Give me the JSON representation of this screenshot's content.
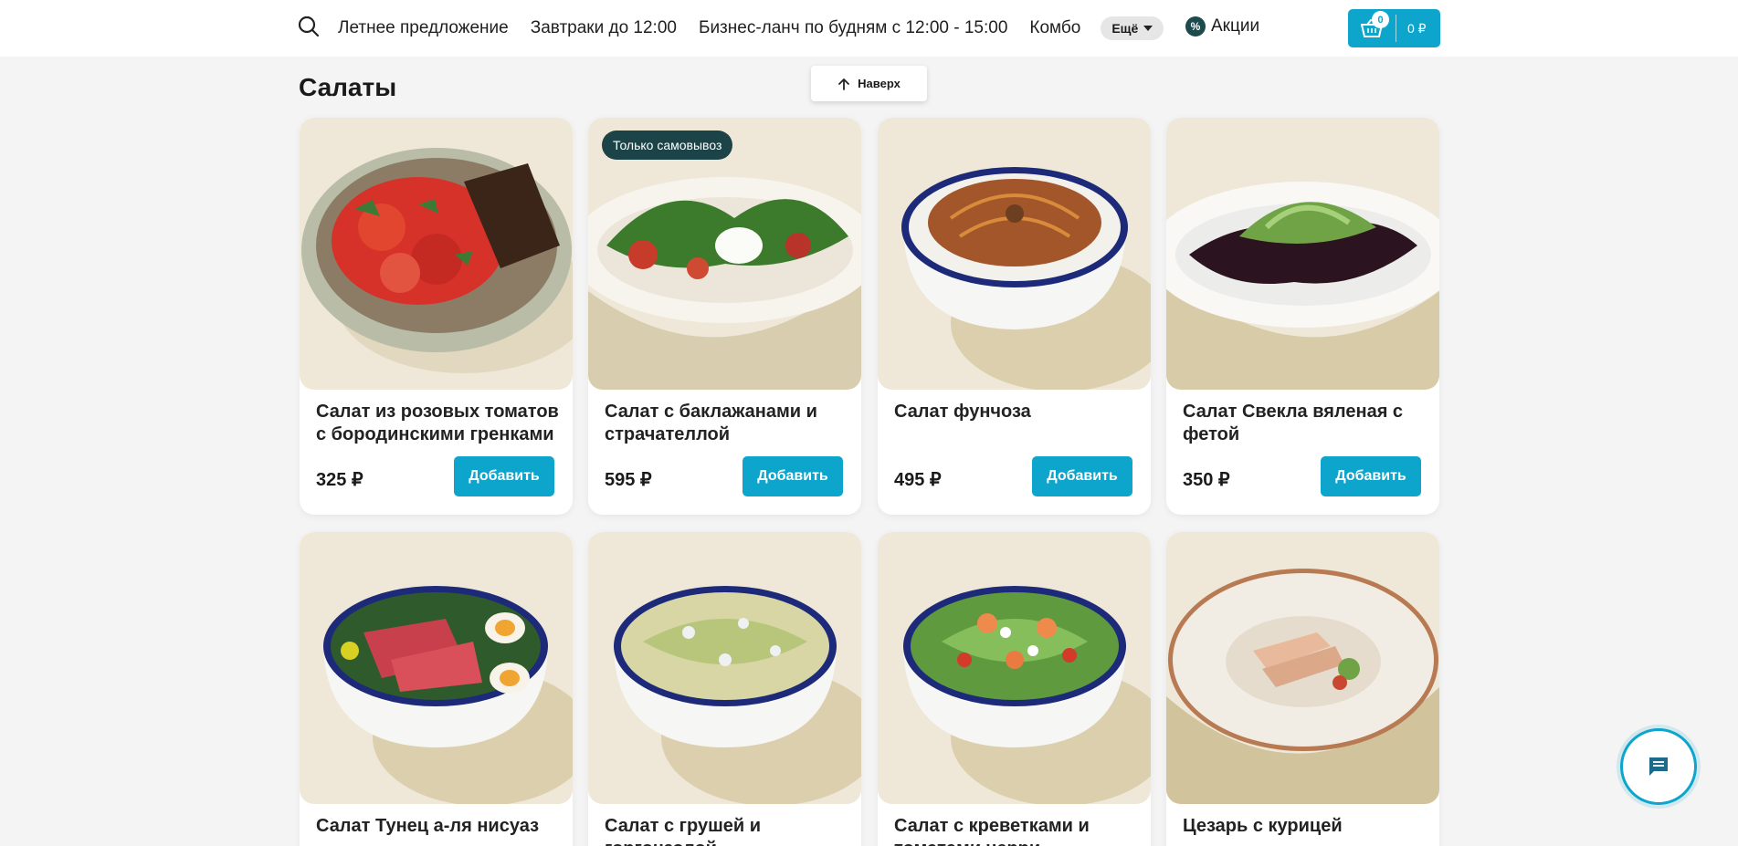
{
  "header": {
    "nav": [
      {
        "label": "Летнее предложение"
      },
      {
        "label": "Завтраки до 12:00"
      },
      {
        "label": "Бизнес-ланч по будням с 12:00 - 15:00"
      },
      {
        "label": "Комбо"
      }
    ],
    "more_label": "Ещё",
    "promo_label": "Акции",
    "cart": {
      "count": "0",
      "total": "0 ₽"
    }
  },
  "section": {
    "title": "Салаты",
    "up_label": "Наверх"
  },
  "products": [
    {
      "name": "Салат из розовых томатов с бородинскими гренками",
      "price": "325 ₽",
      "button": "Добавить",
      "badge": ""
    },
    {
      "name": "Салат с баклажанами и страчателлой",
      "price": "595 ₽",
      "button": "Добавить",
      "badge": "Только самовывоз"
    },
    {
      "name": "Салат фунчоза",
      "price": "495 ₽",
      "button": "Добавить",
      "badge": ""
    },
    {
      "name": "Салат Свекла вяленая с фетой",
      "price": "350 ₽",
      "button": "Добавить",
      "badge": ""
    },
    {
      "name": "Салат Тунец а-ля нисуаз",
      "price": "",
      "button": "",
      "badge": ""
    },
    {
      "name": "Салат с грушей и горгонзолой",
      "price": "",
      "button": "",
      "badge": ""
    },
    {
      "name": "Салат с креветками и томатами черри",
      "price": "",
      "button": "",
      "badge": ""
    },
    {
      "name": "Цезарь с курицей",
      "price": "",
      "button": "",
      "badge": ""
    }
  ],
  "colors": {
    "accent": "#0ea5cc",
    "badge": "#1c4348",
    "page_bg": "#f4f4f4",
    "photo_bg": "#efe8d8"
  },
  "icons": {
    "search": "search-icon",
    "promo": "percent-icon",
    "cart": "basket-icon",
    "up": "arrow-up-icon",
    "chat": "chat-icon"
  }
}
